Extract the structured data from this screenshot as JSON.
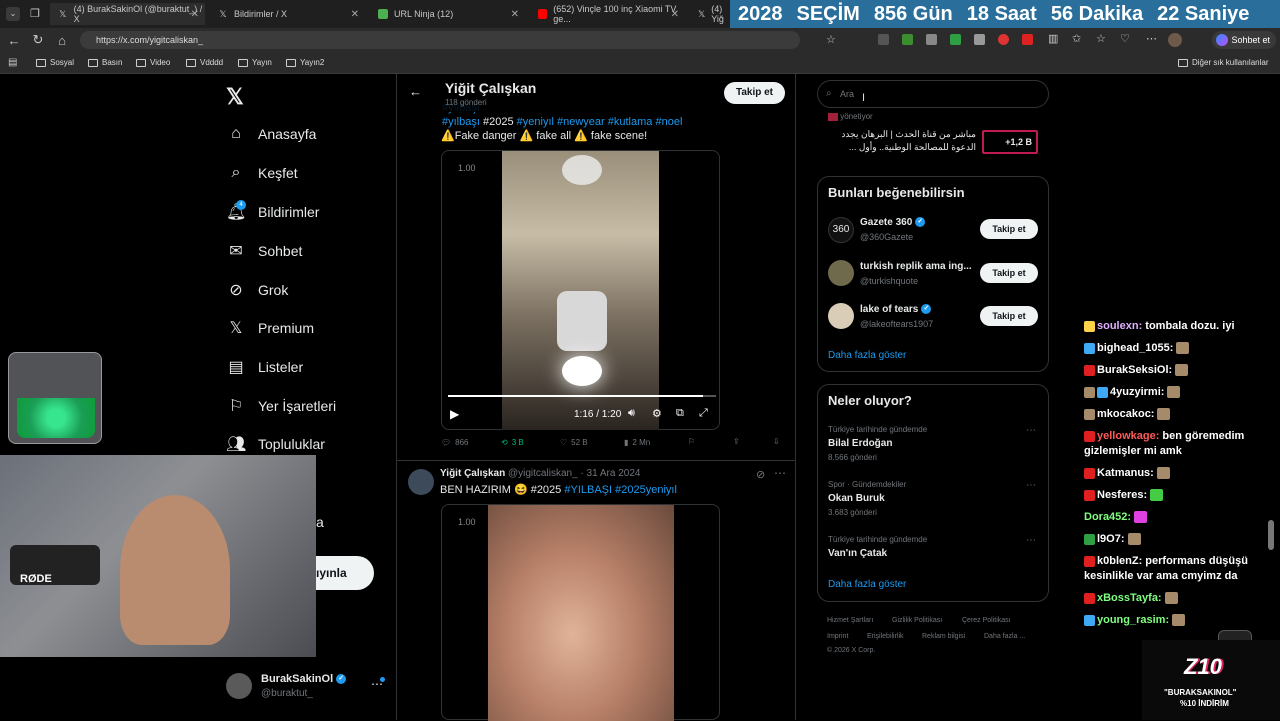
{
  "tabs": [
    {
      "label": "(4) BurakSakinOl (@buraktut_) / X",
      "icon": "x-icon"
    },
    {
      "label": "Bildirimler / X",
      "icon": "x-icon"
    },
    {
      "label": "URL Ninja (12)",
      "icon": "ninja-icon"
    },
    {
      "label": "(652) Vinçle 100 inç Xiaomi TV ge...",
      "icon": "youtube-icon"
    },
    {
      "label": "(4) Yiğ",
      "icon": "x-icon"
    }
  ],
  "countdown": {
    "year": "2028",
    "title": "SEÇİM",
    "days": "856 Gün",
    "hours": "18 Saat",
    "minutes": "56 Dakika",
    "seconds": "22 Saniye"
  },
  "address_bar": {
    "url": "https://x.com/yigitcaliskan_",
    "chat_label": "Sohbet et"
  },
  "bookmarks": [
    "Sosyal",
    "Basın",
    "Video",
    "Vdddd",
    "Yayın",
    "Yayın2"
  ],
  "bookmarks_other": "Diğer sık kullanılanlar",
  "nav": {
    "items": [
      {
        "label": "Anasayfa",
        "icon": "home-icon"
      },
      {
        "label": "Keşfet",
        "icon": "search-icon"
      },
      {
        "label": "Bildirimler",
        "icon": "bell-icon",
        "badge": "4"
      },
      {
        "label": "Sohbet",
        "icon": "mail-icon"
      },
      {
        "label": "Grok",
        "icon": "grok-icon"
      },
      {
        "label": "Premium",
        "icon": "x-premium-icon"
      },
      {
        "label": "Listeler",
        "icon": "list-icon"
      },
      {
        "label": "Yer İşaretleri",
        "icon": "bookmark-icon"
      },
      {
        "label": "Topluluklar",
        "icon": "people-icon"
      }
    ],
    "partial_more": "a",
    "post_button": "ıyınla"
  },
  "profile": {
    "name": "BurakSakinOl",
    "handle": "@buraktut_"
  },
  "header": {
    "name": "Yiğit Çalışkan",
    "posts": "118 gönderi",
    "follow": "Takip et"
  },
  "tweet1": {
    "tags_line": [
      "#yılbaşı",
      "#2025",
      "#yeniyıl",
      "#newyear",
      "#kutlama",
      "#noel"
    ],
    "text": "⚠️Fake danger ⚠️ fake all ⚠️ fake scene!",
    "video_time": "1:16 / 1:20",
    "video_label": "1.00",
    "stats": {
      "replies": "866",
      "reposts": "3 B",
      "likes": "52 B",
      "views": "2 Mn"
    }
  },
  "tweet2": {
    "name": "Yiğit Çalışkan",
    "handle": "@yigitcaliskan_",
    "date": "31 Ara 2024",
    "text_prefix": "BEN HAZIRIM 😆 #2025",
    "tags": [
      "#YILBAŞI",
      "#2025yeniyıl"
    ],
    "video_label": "1.00"
  },
  "search": {
    "placeholder": "Ara"
  },
  "live_card": {
    "text": "مباشر من قناة الحدث | البرهان يجدد الدعوة للمصالحة الوطنية.. وأول ...",
    "count": "+1,2 B",
    "owner": "yönetiyor"
  },
  "suggestions": {
    "title": "Bunları beğenebilirsin",
    "items": [
      {
        "name": "Gazete 360",
        "handle": "@360Gazete",
        "verified": true,
        "button": "Takip et"
      },
      {
        "name": "turkish replik ama ing...",
        "handle": "@turkishquote",
        "verified": false,
        "button": "Takip et"
      },
      {
        "name": "lake of tears",
        "handle": "@lakeoftears1907",
        "verified": true,
        "button": "Takip et"
      }
    ],
    "more": "Daha fazla göster"
  },
  "trends": {
    "title": "Neler oluyor?",
    "items": [
      {
        "category": "Türkiye tarihinde gündemde",
        "name": "Bilal Erdoğan",
        "count": "8.566 gönderi"
      },
      {
        "category": "Spor · Gündemdekiler",
        "name": "Okan Buruk",
        "count": "3.683 gönderi"
      },
      {
        "category": "Türkiye tarihinde gündemde",
        "name": "Van'ın Çatak",
        "count": ""
      }
    ],
    "more": "Daha fazla göster"
  },
  "footer": [
    "Hizmet Şartları",
    "Gizlilik Politikası",
    "Çerez Politikası",
    "Imprint",
    "Erişilebilirlik",
    "Reklam bilgisi",
    "Daha fazla ...",
    "© 2026 X Corp."
  ],
  "chat": [
    {
      "user": "soulexn:",
      "msg": "tombala dozu. iyi",
      "color": "#e0b0ff"
    },
    {
      "user": "bighead_1055:",
      "msg": "",
      "color": "#ffffff"
    },
    {
      "user": "BurakSeksiOl:",
      "msg": "",
      "color": "#ffffff"
    },
    {
      "user": "4yuzyirmi:",
      "msg": "",
      "color": "#ffffff"
    },
    {
      "user": "mkocakoc:",
      "msg": "",
      "color": "#ffffff"
    },
    {
      "user": "yellowkage:",
      "msg": "ben göremedim gizlemişler mi amk",
      "color": "#ff5a5a"
    },
    {
      "user": "Katmanus:",
      "msg": "",
      "color": "#ffffff"
    },
    {
      "user": "Nesferes:",
      "msg": "",
      "color": "#ffffff"
    },
    {
      "user": "Dora452:",
      "msg": "",
      "color": "#7fff7f"
    },
    {
      "user": "l9O7:",
      "msg": "",
      "color": "#ffffff"
    },
    {
      "user": "k0blenZ:",
      "msg": "performans düşüşü kesinlikle var ama cmyimz da",
      "color": "#ffffff"
    },
    {
      "user": "xBossTayfa:",
      "msg": "",
      "color": "#7fff7f"
    },
    {
      "user": "young_rasim:",
      "msg": "",
      "color": "#7fff7f"
    }
  ],
  "sponsor": {
    "line1": "\"BURAKSAKINOL\"",
    "line2": "%10 İNDİRİM",
    "logo": "Z10"
  },
  "webcam": {
    "mic_brand": "RØDE"
  }
}
